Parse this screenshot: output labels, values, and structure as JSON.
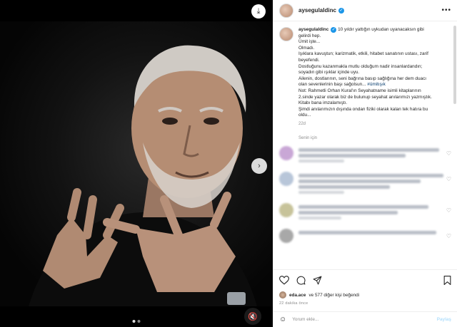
{
  "post": {
    "username": "aysegulaldinc",
    "caption_lines": [
      "10 yıldır yattığın uykudan uyanacaksın gibi",
      "gelirdi hep.",
      "Ümit işte...",
      "Olmadı.",
      "Işıklara kavuştun; karizmatik, etkili, hitabet sanatının ustası, zarif",
      "beyefendi.",
      "Dostluğunu kazanmakla mutlu olduğum nadir insanlardandın;",
      "soyadın gibi ışıklar içinde uyu.",
      "Ailenin, dostlarının, seni bağrına basıp sağlığına her dem duacı",
      "olan sevenlerinin başı sağolsun...",
      "Not: Rahmetli Orhan Kural'ın Seyahatname isimli kitaplarının",
      "2.sinde yazar olarak biz de bulunup seyahat anılarımızı yazmıştık.",
      "Kitabı bana imzalamıştı.",
      "Şimdi anılarımızın dışında ondan fiziki olarak kalan tek hatıra bu",
      "oldu..."
    ],
    "hashtag": "#ümitışık",
    "time": "22d",
    "liked_by_author": "Senin için"
  },
  "icons": {
    "verified": "verified-badge-icon",
    "more": "more-options-icon",
    "like": "heart-icon",
    "comment": "comment-icon",
    "share": "share-icon",
    "save": "bookmark-icon",
    "emoji": "emoji-icon",
    "mute": "muted-speaker-icon",
    "next": "chevron-right-icon"
  },
  "engagement": {
    "first_liker": "eda.ace",
    "rest": "ve 577 diğer kişi beğendi",
    "ago": "22 dakika önce"
  },
  "composer": {
    "placeholder": "Yorum ekle...",
    "submit": "Paylaş"
  },
  "colors": {
    "verified": "#1c96e8",
    "hashtag": "#00376b",
    "secondary_text": "#8e8e8e"
  }
}
